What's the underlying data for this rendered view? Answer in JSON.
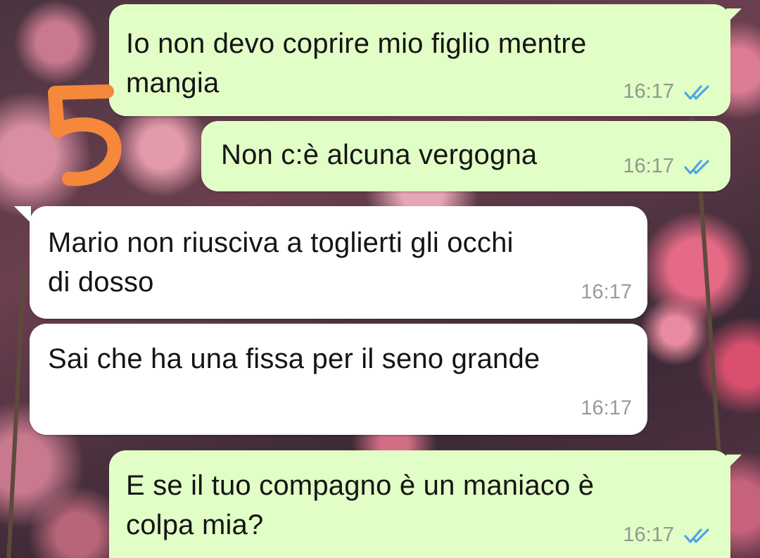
{
  "annotation": {
    "label": "5",
    "color": "#f5883a"
  },
  "colors": {
    "outgoing_bubble": "#e1fec6",
    "incoming_bubble": "#ffffff",
    "read_ticks": "#4fa3e8"
  },
  "messages": [
    {
      "direction": "outgoing",
      "text_lines": [
        "Io non devo coprire mio figlio mentre",
        "mangia"
      ],
      "time": "16:17",
      "status": "read"
    },
    {
      "direction": "outgoing",
      "text_lines": [
        "Non c:è alcuna vergogna"
      ],
      "time": "16:17",
      "status": "read"
    },
    {
      "direction": "incoming",
      "text_lines": [
        "Mario non riusciva a toglierti gli occhi",
        "di dosso"
      ],
      "time": "16:17"
    },
    {
      "direction": "incoming",
      "text_lines": [
        "Sai che ha una fissa per il seno grande"
      ],
      "time": "16:17"
    },
    {
      "direction": "outgoing",
      "text_lines": [
        "E se il tuo compagno è un maniaco è",
        "colpa mia?"
      ],
      "time": "16:17",
      "status": "read"
    }
  ]
}
